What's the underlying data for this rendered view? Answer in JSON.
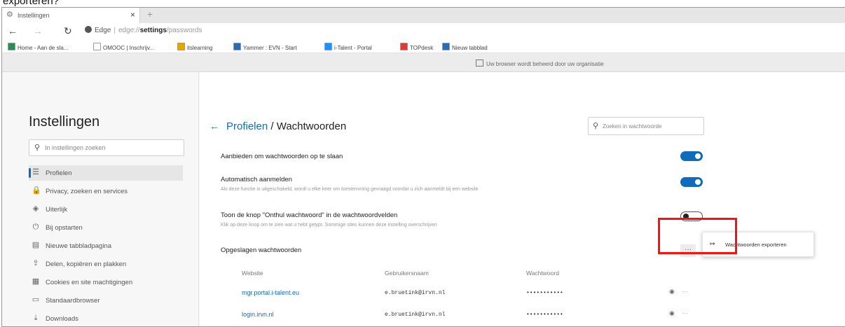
{
  "caption": "exporteren?",
  "browser": {
    "tab_title": "Instellingen",
    "tab_close": "×",
    "new_tab": "+",
    "nav": {
      "back": "←",
      "forward": "→",
      "refresh": "↻"
    },
    "address": {
      "site": "Edge",
      "url_prefix": "edge://",
      "url_strong": "settings",
      "url_rest": "/passwords"
    },
    "bookmarks": [
      {
        "label": "Home - Aan de sla...",
        "color": "#2e8b57"
      },
      {
        "label": "OMOOC | Inschrijv...",
        "color": "#ffffff"
      },
      {
        "label": "itslearning",
        "color": "#e0a800"
      },
      {
        "label": "Yammer : EVN - Start",
        "color": "#2b6cb0"
      },
      {
        "label": "i-Talent - Portal",
        "color": "#1e90ff"
      },
      {
        "label": "TOPdesk",
        "color": "#d43f3a"
      },
      {
        "label": "Nieuw tabblad",
        "color": "#2b6cb0"
      }
    ],
    "managed_text": "Uw browser wordt beheerd door uw organisatie"
  },
  "sidebar": {
    "title": "Instellingen",
    "search_placeholder": "In instellingen zoeken",
    "items": [
      {
        "label": "Profielen",
        "icon": "☰",
        "active": true
      },
      {
        "label": "Privacy, zoeken en services",
        "icon": "🔒",
        "active": false
      },
      {
        "label": "Uiterlijk",
        "icon": "◈",
        "active": false
      },
      {
        "label": "Bij opstarten",
        "icon": "⏻",
        "active": false
      },
      {
        "label": "Nieuwe tabbladpagina",
        "icon": "▤",
        "active": false
      },
      {
        "label": "Delen, kopiëren en plakken",
        "icon": "⇪",
        "active": false
      },
      {
        "label": "Cookies en site machtigingen",
        "icon": "▦",
        "active": false
      },
      {
        "label": "Standaardbrowser",
        "icon": "▭",
        "active": false
      },
      {
        "label": "Downloads",
        "icon": "⤓",
        "active": false
      }
    ]
  },
  "main": {
    "breadcrumb_link": "Profielen",
    "breadcrumb_sep": " / ",
    "breadcrumb_current": "Wachtwoorden",
    "search_placeholder": "Zoeken in wachtwoorde",
    "settings": [
      {
        "label": "Aanbieden om wachtwoorden op te slaan",
        "state": "on"
      },
      {
        "label": "Automatisch aanmelden",
        "state": "on",
        "desc": "Als deze functie is uitgeschakeld, wordt u elke keer om toestemming gevraagd voordat u zich aanmeldt bij een website"
      },
      {
        "label": "Toon de knop \"Onthul wachtwoord\" in de wachtwoordvelden",
        "state": "off",
        "desc": "Klik op deze knop om te zien wat u hebt getypt. Sommige sites kunnen deze instelling overschrijven"
      }
    ],
    "saved_heading": "Opgeslagen wachtwoorden",
    "more_label": "···",
    "columns": [
      "Website",
      "Gebruikersnaam",
      "Wachtwoord"
    ],
    "rows": [
      {
        "website": "mgr.portal.i-talent.eu",
        "username": "e.bruetink@irvn.nl",
        "password": "•••••••••••"
      },
      {
        "website": "login.irvn.nl",
        "username": "e.bruetink@irvn.nl",
        "password": "•••••••••••"
      }
    ],
    "context_menu": {
      "icon": "↦",
      "label": "Wachtwoorden exporteren"
    }
  }
}
